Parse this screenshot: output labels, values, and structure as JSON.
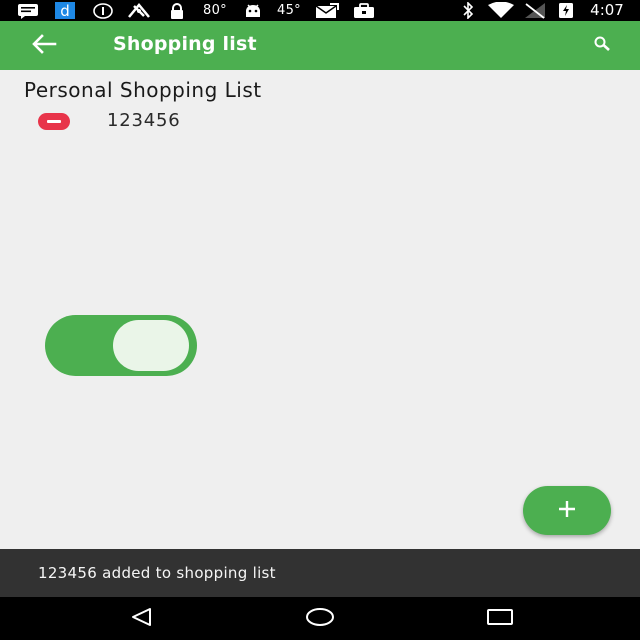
{
  "status_bar": {
    "temp_1": "80°",
    "temp_2": "45°",
    "time": "4:07",
    "icons": [
      "message-icon",
      "d-app-icon",
      "info-icon",
      "fan-icon",
      "lock-icon",
      "android-icon",
      "mail-icon",
      "briefcase-icon",
      "bluetooth-icon",
      "wifi-icon",
      "no-signal-icon",
      "battery-charging-icon"
    ]
  },
  "app_bar": {
    "title": "Shopping list",
    "back_icon": "arrow-back-icon",
    "search_icon": "search-icon",
    "color": "#4caf50"
  },
  "list": {
    "title": "Personal Shopping List",
    "items": [
      {
        "label": "123456",
        "remove_icon": "remove-circle-icon"
      }
    ]
  },
  "toggle": {
    "state": "on",
    "color": "#4caf50"
  },
  "fab": {
    "icon": "plus-icon"
  },
  "snackbar": {
    "message": "123456 added to shopping list"
  },
  "nav_bar": {
    "icons": [
      "back-triangle-icon",
      "home-circle-icon",
      "recents-square-icon"
    ]
  },
  "colors": {
    "accent": "#4caf50",
    "remove": "#e8344a",
    "snackbar": "#323232"
  }
}
